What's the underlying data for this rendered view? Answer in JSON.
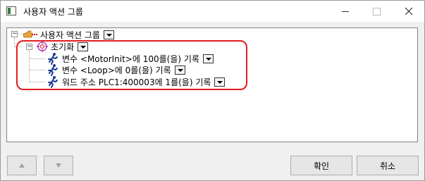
{
  "window": {
    "title": "사용자 액션 그룹",
    "app_icon": "app-window-icon",
    "controls": [
      "minimize-icon",
      "maximize-icon",
      "close-icon"
    ]
  },
  "tree": {
    "root": {
      "label": "사용자 액션 그룹",
      "icon": "folder-action-icon",
      "expanded": true
    },
    "group": {
      "label": "초기화",
      "icon": "target-icon",
      "expanded": true
    },
    "actions": [
      {
        "label": "변수 <MotorInit>에 100를(을) 기록",
        "icon": "running-man-icon"
      },
      {
        "label": "변수 <Loop>에 0를(을) 기록",
        "icon": "running-man-icon"
      },
      {
        "label": "워드 주소 PLC1:400003에 1를(을) 기록",
        "icon": "running-man-icon"
      }
    ]
  },
  "footer": {
    "up_icon": "arrow-up-icon",
    "down_icon": "arrow-down-icon",
    "ok_label": "확인",
    "cancel_label": "취소"
  },
  "colors": {
    "highlight_border": "#e21c1c",
    "action_icon": "#1f3b8f"
  }
}
